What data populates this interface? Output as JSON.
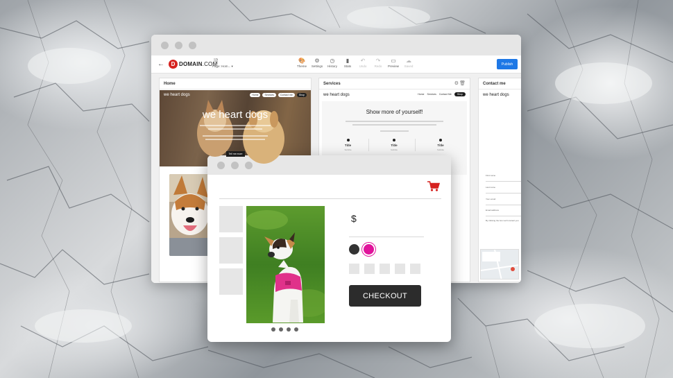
{
  "editor": {
    "logo_letter": "D",
    "logo_name": "DOMAIN",
    "logo_suffix": ".COM",
    "page_select_label": "Page: Hom...",
    "tools": [
      {
        "label": "Theme",
        "icon": "palette-icon",
        "enabled": true
      },
      {
        "label": "Settings",
        "icon": "gear-icon",
        "enabled": true
      },
      {
        "label": "History",
        "icon": "history-icon",
        "enabled": true
      },
      {
        "label": "Stats",
        "icon": "bar-chart-icon",
        "enabled": true
      },
      {
        "label": "Undo",
        "icon": "undo-icon",
        "enabled": false
      },
      {
        "label": "Redo",
        "icon": "redo-icon",
        "enabled": false
      },
      {
        "label": "Preview",
        "icon": "monitor-icon",
        "enabled": true
      },
      {
        "label": "Saved",
        "icon": "cloud-icon",
        "enabled": false
      }
    ],
    "publish_label": "Publish",
    "panels": {
      "home": {
        "title": "Home",
        "brand": "we heart dogs",
        "nav": [
          "Home",
          "Services",
          "Contact me",
          "Shop"
        ],
        "hero_title": "we heart dogs",
        "hero_button": "Tell me more"
      },
      "services": {
        "title": "Services",
        "brand": "we heart dogs",
        "nav": [
          "Home",
          "Services",
          "Contact Me",
          "Shop"
        ],
        "heading": "Show more of yourself!",
        "columns": [
          {
            "title": "Title",
            "subtitle": "Subtitle"
          },
          {
            "title": "Title",
            "subtitle": "Subtitle"
          },
          {
            "title": "Title",
            "subtitle": "Subtitle"
          }
        ]
      },
      "contact": {
        "title": "Contact me",
        "brand": "we heart dogs",
        "fields": [
          "First name",
          "Last name",
          "Your email",
          "Email address"
        ],
        "checkbox_label": "By clicking the box we'll contact you"
      }
    }
  },
  "shop": {
    "price": "$",
    "swatches": [
      {
        "name": "charcoal",
        "color": "#333333"
      },
      {
        "name": "magenta",
        "color": "#e0139b"
      }
    ],
    "size_options_count": 5,
    "checkout_label": "CHECKOUT",
    "carousel_dots": 4,
    "accent_color": "#d6221f"
  }
}
